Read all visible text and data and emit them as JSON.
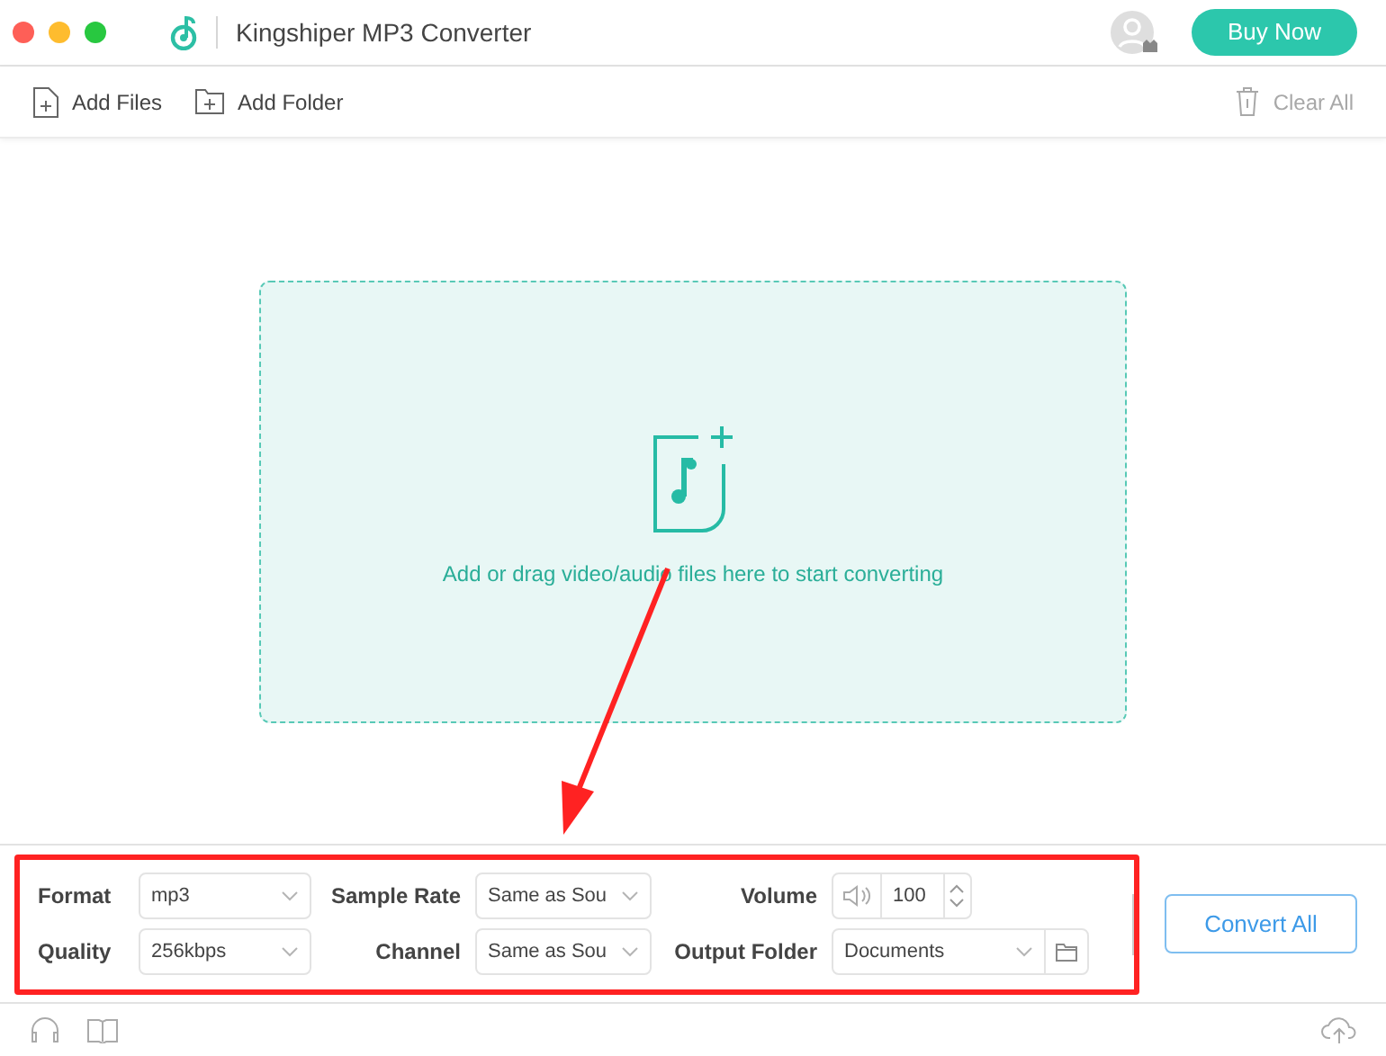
{
  "window": {
    "title": "Kingshiper MP3 Converter"
  },
  "header": {
    "buy_button": "Buy Now"
  },
  "toolbar": {
    "add_files": "Add Files",
    "add_folder": "Add Folder",
    "clear_all": "Clear All",
    "clear_all_disabled": true
  },
  "drop_zone": {
    "hint": "Add or drag video/audio files here to start converting"
  },
  "settings": {
    "format": {
      "label": "Format",
      "value": "mp3"
    },
    "sample_rate": {
      "label": "Sample Rate",
      "value": "Same as Sou"
    },
    "volume": {
      "label": "Volume",
      "value": "100"
    },
    "quality": {
      "label": "Quality",
      "value": "256kbps"
    },
    "channel": {
      "label": "Channel",
      "value": "Same as Sou"
    },
    "output_folder": {
      "label": "Output Folder",
      "value": "Documents"
    }
  },
  "convert_button": "Convert All"
}
